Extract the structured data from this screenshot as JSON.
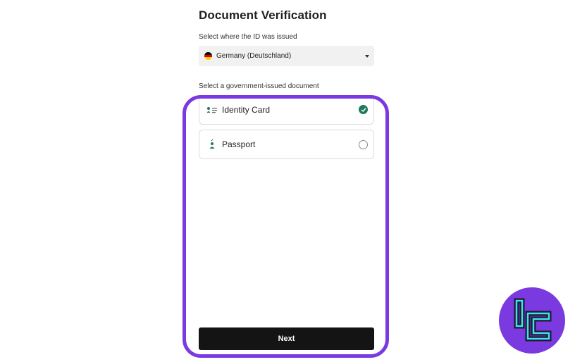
{
  "page": {
    "title": "Document Verification",
    "country_label": "Select where the ID was issued",
    "document_label": "Select a government-issued document"
  },
  "country_select": {
    "value": "Germany (Deutschland)",
    "flag_icon": "germany-flag-icon",
    "flag_colors": [
      "#000000",
      "#dd0000",
      "#ffce00"
    ]
  },
  "documents": [
    {
      "label": "Identity Card",
      "icon": "id-card-icon",
      "selected": true
    },
    {
      "label": "Passport",
      "icon": "passport-person-icon",
      "selected": false
    }
  ],
  "actions": {
    "next_label": "Next"
  },
  "colors": {
    "accent": "#1e7a5a",
    "highlight": "#7a3ae0",
    "button": "#141414"
  },
  "logo": {
    "icon": "tc-brand-logo-icon"
  }
}
